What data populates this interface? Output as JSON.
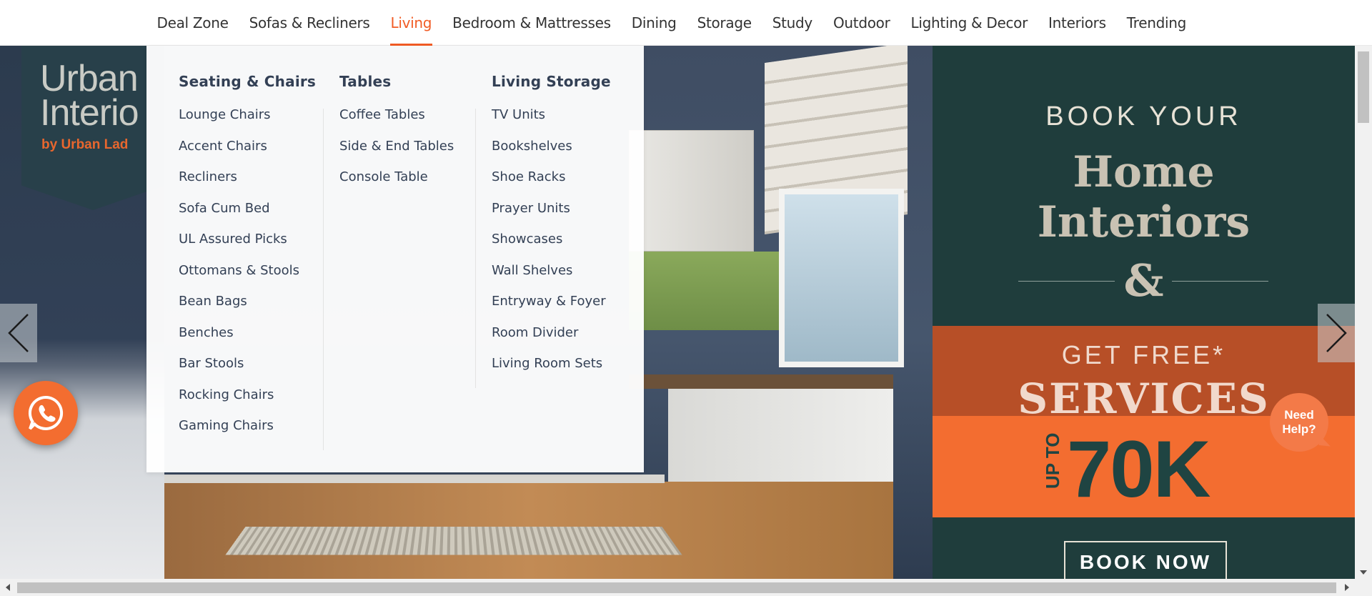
{
  "nav": {
    "items": [
      {
        "label": "Deal Zone"
      },
      {
        "label": "Sofas & Recliners"
      },
      {
        "label": "Living"
      },
      {
        "label": "Bedroom & Mattresses"
      },
      {
        "label": "Dining"
      },
      {
        "label": "Storage"
      },
      {
        "label": "Study"
      },
      {
        "label": "Outdoor"
      },
      {
        "label": "Lighting & Decor"
      },
      {
        "label": "Interiors"
      },
      {
        "label": "Trending"
      }
    ],
    "active": "Living",
    "accent_color": "#f15c25"
  },
  "mega_menu": {
    "columns": [
      {
        "heading": "Seating & Chairs",
        "items": [
          "Lounge Chairs",
          "Accent Chairs",
          "Recliners",
          "Sofa Cum Bed",
          "UL Assured Picks",
          "Ottomans & Stools",
          "Bean Bags",
          "Benches",
          "Bar Stools",
          "Rocking Chairs",
          "Gaming Chairs"
        ]
      },
      {
        "heading": "Tables",
        "items": [
          "Coffee Tables",
          "Side & End Tables",
          "Console Table"
        ]
      },
      {
        "heading": "Living Storage",
        "items": [
          "TV Units",
          "Bookshelves",
          "Shoe Racks",
          "Prayer Units",
          "Showcases",
          "Wall Shelves",
          "Entryway & Foyer",
          "Room Divider",
          "Living Room Sets"
        ]
      }
    ]
  },
  "banner": {
    "logo_line1": "Urban",
    "logo_line2": "Interio",
    "logo_sub": "by Urban Lad",
    "book_your": "BOOK YOUR",
    "home": "Home",
    "interiors": "Interiors",
    "ampersand": "&",
    "get_free": "GET FREE*",
    "services": "SERVICES",
    "upto": "UP TO",
    "amount": "70K",
    "cta": "BOOK NOW",
    "colors": {
      "dark_teal": "#1f3d3c",
      "orange": "#f36d30",
      "rust": "#b74f27"
    }
  },
  "floating": {
    "whatsapp_icon": "whatsapp-icon",
    "help_line1": "Need",
    "help_line2": "Help?"
  }
}
